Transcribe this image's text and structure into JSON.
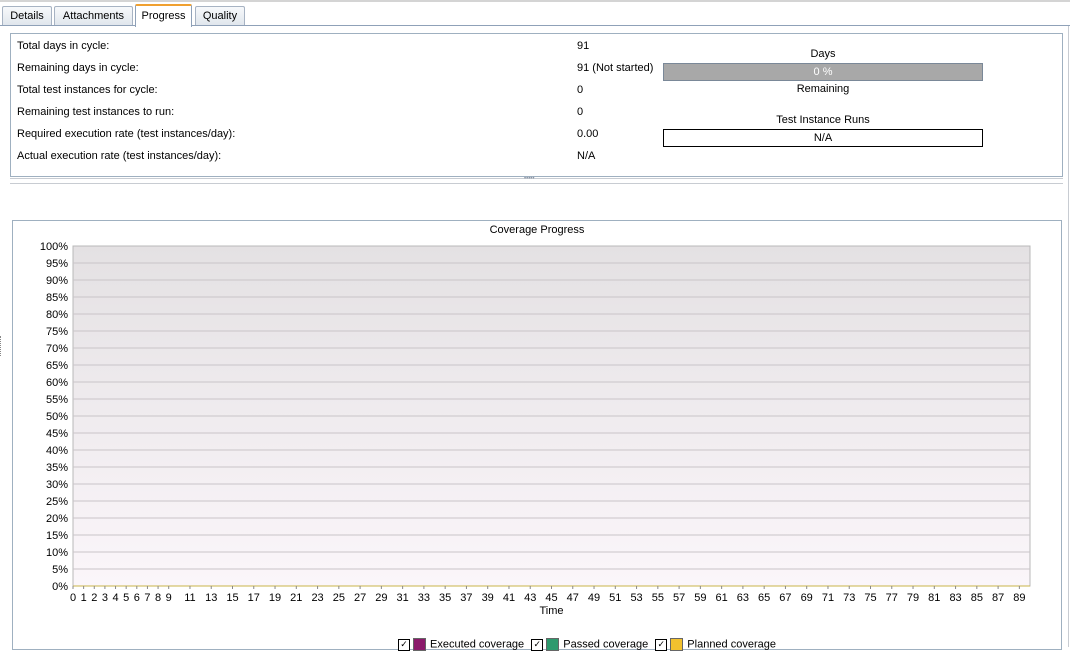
{
  "tabs": [
    {
      "label": "Details",
      "active": false
    },
    {
      "label": "Attachments",
      "active": false
    },
    {
      "label": "Progress",
      "active": true
    },
    {
      "label": "Quality",
      "active": false
    }
  ],
  "summary": {
    "rows": [
      {
        "label": "Total days in cycle:",
        "value": "91"
      },
      {
        "label": "Remaining days in cycle:",
        "value": "91 (Not started)"
      },
      {
        "label": "Total test instances for cycle:",
        "value": "0"
      },
      {
        "label": "Remaining test instances to run:",
        "value": "0"
      },
      {
        "label": "Required execution rate (test instances/day):",
        "value": "0.00"
      },
      {
        "label": "Actual execution rate (test instances/day):",
        "value": "N/A"
      }
    ],
    "days_widget": {
      "title": "Days",
      "bar_text": "0 %",
      "fill_fraction": 0,
      "caption": "Remaining"
    },
    "runs_widget": {
      "title": "Test Instance Runs",
      "bar_text": "N/A"
    }
  },
  "chart_data": {
    "type": "line",
    "title": "Coverage Progress",
    "xlabel": "Time",
    "ylabel": "",
    "xlim": [
      0,
      90
    ],
    "ylim": [
      0,
      100
    ],
    "y_ticks": [
      "0%",
      "5%",
      "10%",
      "15%",
      "20%",
      "25%",
      "30%",
      "35%",
      "40%",
      "45%",
      "50%",
      "55%",
      "60%",
      "65%",
      "70%",
      "75%",
      "80%",
      "85%",
      "90%",
      "95%",
      "100%"
    ],
    "x_ticks": [
      "0",
      "1",
      "2",
      "3",
      "4",
      "5",
      "6",
      "7",
      "8",
      "9",
      "11",
      "13",
      "15",
      "17",
      "19",
      "21",
      "23",
      "25",
      "27",
      "29",
      "31",
      "33",
      "35",
      "37",
      "39",
      "41",
      "43",
      "45",
      "47",
      "49",
      "51",
      "53",
      "55",
      "57",
      "59",
      "61",
      "63",
      "65",
      "67",
      "69",
      "71",
      "73",
      "75",
      "77",
      "79",
      "81",
      "83",
      "85",
      "87",
      "89"
    ],
    "grid": true,
    "legend_position": "bottom",
    "series": [
      {
        "name": "Executed coverage",
        "color": "#8b1a6b",
        "checked": true,
        "values": []
      },
      {
        "name": "Passed coverage",
        "color": "#2e9a6e",
        "checked": true,
        "values": []
      },
      {
        "name": "Planned coverage",
        "color": "#f2c12e",
        "checked": true,
        "values": []
      }
    ]
  }
}
